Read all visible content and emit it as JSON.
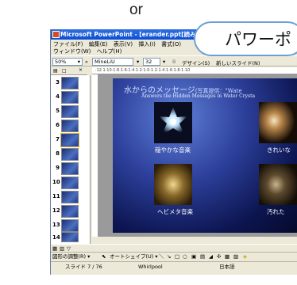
{
  "top_word": "or",
  "callout": {
    "text": "パワーポ"
  },
  "window": {
    "title": "Microsoft PowerPoint - [erander.ppt[読み専",
    "menu_row1": [
      "ファイル(F)",
      "編集(E)",
      "表示(V)",
      "挿入(I)",
      "書式(O)"
    ],
    "menu_row2": [
      "ウィンドウ(W)",
      "ヘルプ(H)"
    ],
    "zoom": "50%",
    "font_name": "MineLiU",
    "font_size": "32",
    "design_label": "デザイン(S)",
    "new_slide_label": "新しいスライド(N)",
    "ruler_marks": "·12·1·10·1·8·1·6·1·4·1·2·1·0·1·2·1·4·1·6·1·8·1·10",
    "panel_tab_outline": "▤",
    "panel_tab_slides": "□",
    "panel_close": "×"
  },
  "thumbnails": [
    {
      "num": "3"
    },
    {
      "num": "4"
    },
    {
      "num": "5"
    },
    {
      "num": "6"
    },
    {
      "num": "7"
    },
    {
      "num": "8"
    },
    {
      "num": "9"
    },
    {
      "num": "10"
    },
    {
      "num": "11"
    },
    {
      "num": "12"
    },
    {
      "num": "13"
    },
    {
      "num": "14"
    }
  ],
  "slide": {
    "title_jp": "水からのメッセージ",
    "title_note": "(写真提供：\"Wate",
    "subtitle": "Answers the Hidden Messages in Water Crysta",
    "captions": [
      "穏やかな音楽",
      "きれいな",
      "ヘビメタ音楽",
      "汚れた"
    ]
  },
  "draw_toolbar": {
    "draw_label": "図形の調整(R) ▾",
    "autoshape_label": "オートシェイプ(U) ▾"
  },
  "status": {
    "slide_pos": "スライド 7 / 76",
    "design": "Whirlpool",
    "language": "日本語"
  },
  "colors": {
    "titlebar": "#0a4ed6",
    "callout_border": "#6d9fd6",
    "slide_bg": "#2c3f9a"
  }
}
